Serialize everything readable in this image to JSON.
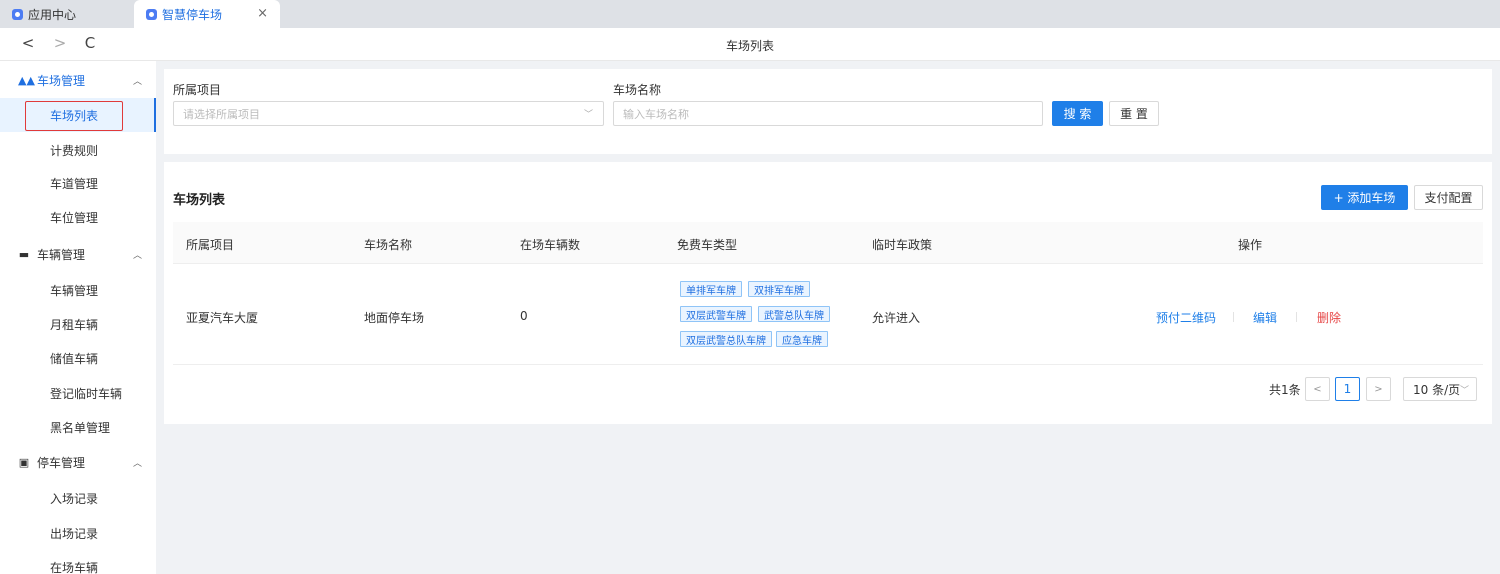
{
  "tabs": [
    {
      "label": "应用中心"
    },
    {
      "label": "智慧停车场",
      "close": "×"
    }
  ],
  "nav": {
    "back": "<",
    "forward": ">",
    "reload": "C",
    "title": "车场列表"
  },
  "sidebar": {
    "groups": [
      {
        "label": "车场管理",
        "icon": "road-icon",
        "items": [
          "车场列表",
          "计费规则",
          "车道管理",
          "车位管理"
        ]
      },
      {
        "label": "车辆管理",
        "icon": "car-icon",
        "items": [
          "车辆管理",
          "月租车辆",
          "储值车辆",
          "登记临时车辆",
          "黑名单管理"
        ]
      },
      {
        "label": "停车管理",
        "icon": "parking-icon",
        "items": [
          "入场记录",
          "出场记录",
          "在场车辆"
        ]
      }
    ]
  },
  "filter": {
    "project_label": "所属项目",
    "project_placeholder": "请选择所属项目",
    "name_label": "车场名称",
    "name_placeholder": "输入车场名称",
    "search_btn": "搜 索",
    "reset_btn": "重 置"
  },
  "list": {
    "title": "车场列表",
    "add_btn": "+ 添加车场",
    "pay_btn": "支付配置",
    "columns": [
      "所属项目",
      "车场名称",
      "在场车辆数",
      "免费车类型",
      "临时车政策",
      "操作"
    ],
    "rows": [
      {
        "project": "亚夏汽车大厦",
        "name": "地面停车场",
        "count": "0",
        "free_types": [
          "单排军车牌",
          "双排军车牌",
          "双层武警车牌",
          "武警总队车牌",
          "双层武警总队车牌",
          "应急车牌"
        ],
        "policy": "允许进入",
        "ops": [
          "预付二维码",
          "编辑",
          "删除"
        ]
      }
    ]
  },
  "pagination": {
    "total": "共1条",
    "prev": "<",
    "page": "1",
    "next": ">",
    "page_size": "10 条/页"
  },
  "colors": {
    "primary": "#1f7fe8",
    "danger": "#e64646",
    "tag_bg": "#eaf4ff"
  }
}
